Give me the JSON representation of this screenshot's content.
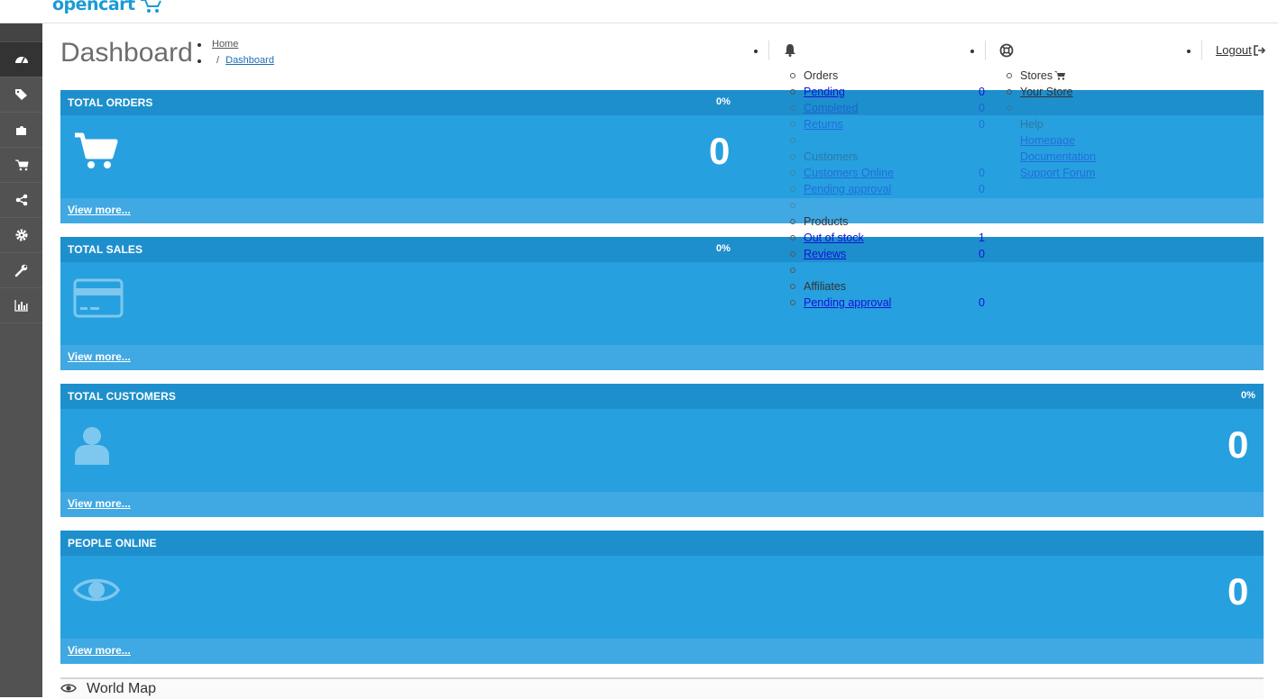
{
  "app": {
    "logo_text": "opencart",
    "brand_color": "#1b9ad6"
  },
  "header": {
    "page_title": "Dashboard",
    "breadcrumb": {
      "home": "Home",
      "separator": "/",
      "current": "Dashboard"
    },
    "logout_label": "Logout"
  },
  "sidebar": {
    "items": [
      {
        "icon": "dashboard-icon",
        "active": true
      },
      {
        "icon": "tags-icon",
        "active": false
      },
      {
        "icon": "puzzle-icon",
        "active": false
      },
      {
        "icon": "cart-icon",
        "active": false
      },
      {
        "icon": "share-icon",
        "active": false
      },
      {
        "icon": "gear-icon",
        "active": false
      },
      {
        "icon": "wrench-icon",
        "active": false
      },
      {
        "icon": "bar-chart-icon",
        "active": false
      }
    ]
  },
  "tiles": [
    {
      "title": "TOTAL ORDERS",
      "percent": "0%",
      "value": "0",
      "link": "View more...",
      "icon": "cart-icon"
    },
    {
      "title": "TOTAL SALES",
      "percent": "0%",
      "value": "",
      "link": "View more...",
      "icon": "credit-card-icon"
    },
    {
      "title": "TOTAL CUSTOMERS",
      "percent": "0%",
      "value": "0",
      "link": "View more...",
      "icon": "user-icon"
    },
    {
      "title": "PEOPLE ONLINE",
      "percent": "",
      "value": "0",
      "link": "View more...",
      "icon": "eye-icon"
    }
  ],
  "notifications": {
    "orders_header": "Orders",
    "pending": "Pending",
    "pending_count": "0",
    "completed": "Completed",
    "completed_count": "0",
    "returns": "Returns",
    "returns_count": "0",
    "customers_header": "Customers",
    "customers_online": "Customers Online",
    "customers_online_count": "0",
    "pending_approval": "Pending approval",
    "pending_approval_count": "0",
    "products_header": "Products",
    "out_of_stock": "Out of stock",
    "out_of_stock_count": "1",
    "reviews": "Reviews",
    "reviews_count": "0",
    "affiliates_header": "Affiliates",
    "affiliates_pending": "Pending approval",
    "affiliates_pending_count": "0"
  },
  "help_menu": {
    "stores_header": "Stores",
    "your_store": "Your Store",
    "help_header": "Help",
    "homepage": "Homepage",
    "documentation": "Documentation",
    "support_forum": "Support Forum"
  },
  "world_map": {
    "title": "World Map"
  }
}
